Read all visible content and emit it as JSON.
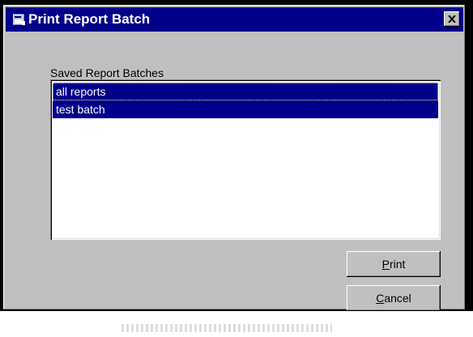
{
  "window": {
    "title": "Print Report Batch",
    "close_icon": "close-icon"
  },
  "batches": {
    "label": "Saved Report Batches",
    "items": [
      {
        "label": "all reports",
        "selected": true
      },
      {
        "label": "test batch",
        "selected": true
      }
    ]
  },
  "buttons": {
    "print": {
      "mnemonic": "P",
      "rest": "rint"
    },
    "cancel": {
      "mnemonic": "C",
      "rest": "ancel"
    }
  },
  "colors": {
    "titlebar": "#00008b",
    "selection": "#00008b",
    "face": "#c0c0c0"
  }
}
